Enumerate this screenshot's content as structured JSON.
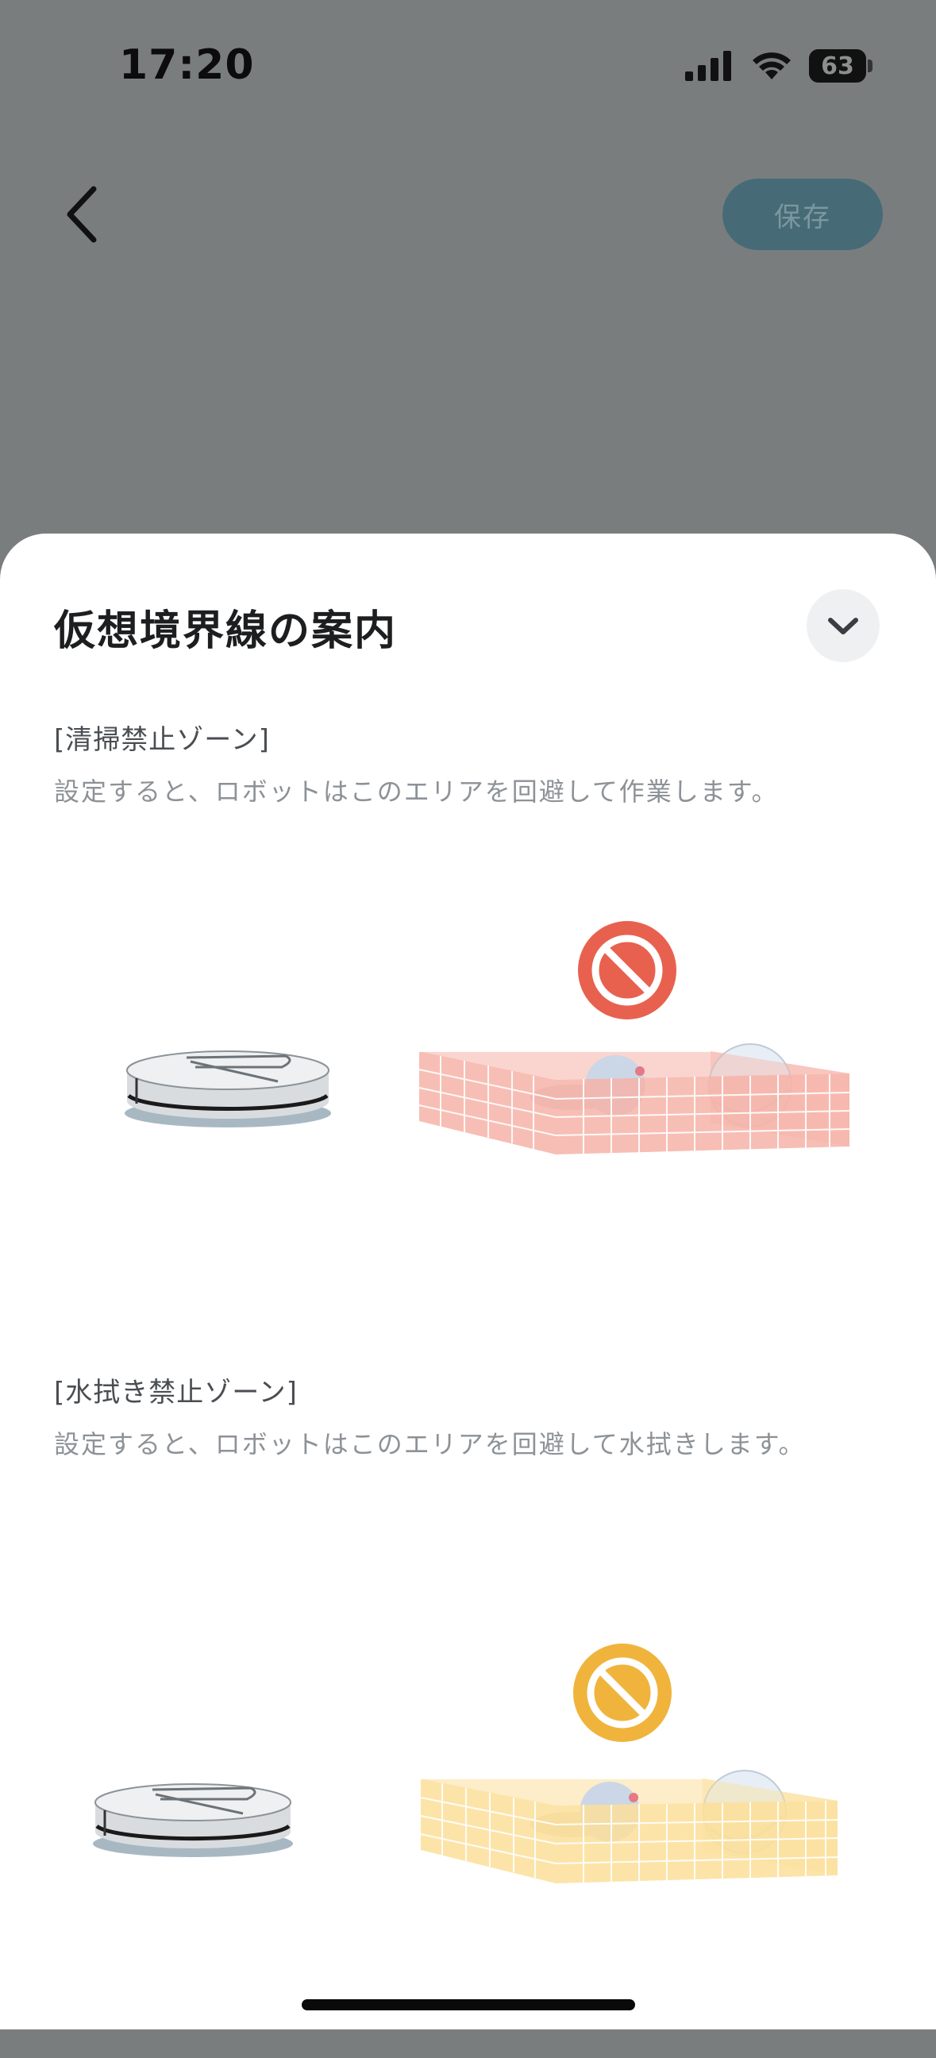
{
  "status_bar": {
    "time": "17:20",
    "battery_level": "63",
    "battery_fraction": 0.63
  },
  "header": {
    "save_label": "保存"
  },
  "sheet": {
    "title": "仮想境界線の案内",
    "sections": [
      {
        "heading": "[清掃禁止ゾーン]",
        "description": "設定すると、ロボットはこのエリアを回避して作業します。",
        "accent_color": "#e8614f",
        "zone_fill": "#f6b3a8"
      },
      {
        "heading": "[水拭き禁止ゾーン]",
        "description": "設定すると、ロボットはこのエリアを回避して水拭きします。",
        "accent_color": "#f0b43c",
        "zone_fill": "#fbdf9a"
      }
    ]
  },
  "icons": {
    "back": "chevron-left-icon",
    "collapse": "chevron-down-icon",
    "prohibited": "no-entry-icon"
  }
}
